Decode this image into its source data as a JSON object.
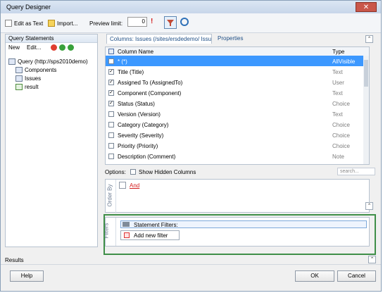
{
  "window": {
    "title": "Query Designer",
    "close": "✕"
  },
  "toolbar": {
    "edit_as_text": "Edit as Text",
    "import": "Import...",
    "preview_limit_label": "Preview limit:",
    "preview_limit_value": "0",
    "warning": "!"
  },
  "left": {
    "header": "Query Statements",
    "new": "New",
    "edit": "Edit...",
    "tree": [
      {
        "label": "Query (http://sps2010demo)"
      },
      {
        "label": "Components"
      },
      {
        "label": "Issues"
      },
      {
        "label": "result"
      }
    ]
  },
  "tabs": {
    "columns": "Columns: Issues (/sites/ersdedemo/ Issues)",
    "properties": "Properties",
    "collapse": "⌃"
  },
  "grid": {
    "col_name": "Column Name",
    "col_type": "Type",
    "rows": [
      {
        "name": "* (*)",
        "type": "AllVisible",
        "checked": "",
        "selected": true
      },
      {
        "name": "Title (Title)",
        "type": "Text",
        "checked": "✓",
        "selected": false
      },
      {
        "name": "Assigned To (AssignedTo)",
        "type": "User",
        "checked": "✓",
        "selected": false
      },
      {
        "name": "Component (Component)",
        "type": "Text",
        "checked": "✓",
        "selected": false
      },
      {
        "name": "Status (Status)",
        "type": "Choice",
        "checked": "✓",
        "selected": false
      },
      {
        "name": "Version (Version)",
        "type": "Text",
        "checked": "",
        "selected": false
      },
      {
        "name": "Category (Category)",
        "type": "Choice",
        "checked": "",
        "selected": false
      },
      {
        "name": "Severity (Severity)",
        "type": "Choice",
        "checked": "",
        "selected": false
      },
      {
        "name": "Priority (Priority)",
        "type": "Choice",
        "checked": "",
        "selected": false
      },
      {
        "name": "Description (Comment)",
        "type": "Note",
        "checked": "",
        "selected": false
      }
    ]
  },
  "options": {
    "label": "Options:",
    "show_hidden": "Show Hidden Columns",
    "search_placeholder": "search..."
  },
  "orderby": {
    "label": "Order By",
    "and": "And"
  },
  "filters": {
    "label": "Filters",
    "statement_filters": "Statement Filters:",
    "add_new_filter": "Add new filter"
  },
  "footer": {
    "results": "Results",
    "help": "Help",
    "ok": "OK",
    "cancel": "Cancel"
  },
  "colors": {
    "selection": "#3c98ff",
    "highlight_border": "#3f8f48",
    "and_text": "#d31b1b"
  }
}
